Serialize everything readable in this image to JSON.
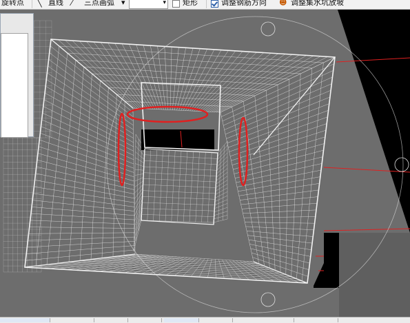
{
  "toolbar": {
    "rotate_point_label": "旋转点",
    "line_label": "直线",
    "arc_label": "三点画弧",
    "arc_dropdown": "▾",
    "combo_value": "",
    "rectangle_label": "矩形",
    "rebar_dir_label": "调整钢筋方向",
    "rebar_dir_checked": true,
    "sump_slope_label": "调整集水坑放坡"
  },
  "colors": {
    "viewport": "#6d6d6d",
    "wire": "#f2f2f2",
    "red_highlight": "#e02020",
    "black_region": "#000000"
  },
  "annotations": {
    "count": 3,
    "meaning": "red ellipse highlights"
  }
}
